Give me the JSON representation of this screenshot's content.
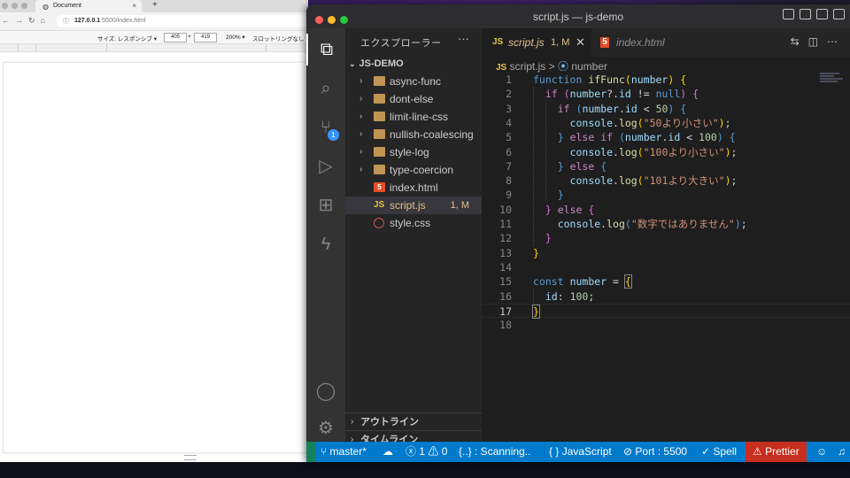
{
  "browser": {
    "tab_title": "Document",
    "new_tab": "+",
    "url_host": "127.0.0.1",
    "url_rest": ":5500/index.html",
    "device_label": "サイズ: レスポンシブ ▾",
    "width": "405",
    "times": "×",
    "height": "419",
    "zoom": "200% ▾",
    "throttle": "スロットリングなし"
  },
  "vscode": {
    "window_title": "script.js — js-demo",
    "lights": [
      "#ff5f57",
      "#febc2e",
      "#28c840"
    ],
    "activity": {
      "explorer_icon": "explorer-icon",
      "search_icon": "search-icon",
      "scm_icon": "source-control-icon",
      "scm_badge": "1",
      "debug_icon": "run-debug-icon",
      "extensions_icon": "extensions-icon",
      "bolt_icon": "bolt-icon",
      "account_icon": "account-icon",
      "settings_icon": "gear-icon"
    },
    "sidebar": {
      "header": "エクスプローラー",
      "more": "···",
      "root": "JS-DEMO",
      "items": [
        {
          "name": "async-func",
          "type": "folder"
        },
        {
          "name": "dont-else",
          "type": "folder"
        },
        {
          "name": "limit-line-css",
          "type": "folder"
        },
        {
          "name": "nullish-coalescing",
          "type": "folder"
        },
        {
          "name": "style-log",
          "type": "folder"
        },
        {
          "name": "type-coercion",
          "type": "folder"
        },
        {
          "name": "index.html",
          "type": "html"
        },
        {
          "name": "script.js",
          "type": "js",
          "status": "1, M"
        },
        {
          "name": "style.css",
          "type": "css"
        }
      ],
      "outline": "アウトライン",
      "timeline": "タイムライン"
    },
    "tabs": [
      {
        "icon": "JS",
        "name": "script.js",
        "status": "1, M",
        "close": "✕"
      },
      {
        "icon": "5",
        "name": "index.html"
      }
    ],
    "breadcrumb": {
      "file_icon": "JS",
      "file": "script.js",
      "sep": ">",
      "symbol_icon": "⦿",
      "symbol": "number"
    },
    "line_numbers": [
      "1",
      "2",
      "3",
      "4",
      "5",
      "6",
      "7",
      "8",
      "9",
      "10",
      "11",
      "12",
      "13",
      "14",
      "15",
      "16",
      "17",
      "18"
    ],
    "status": {
      "branch": "master*",
      "sync": "☁",
      "errors": "1",
      "warnings": "0",
      "scanning": "{..} : Scanning..",
      "language": "JavaScript",
      "lang_braces": "{ }",
      "port": "Port : 5500",
      "spell": "Spell",
      "prettier": "Prettier"
    }
  }
}
